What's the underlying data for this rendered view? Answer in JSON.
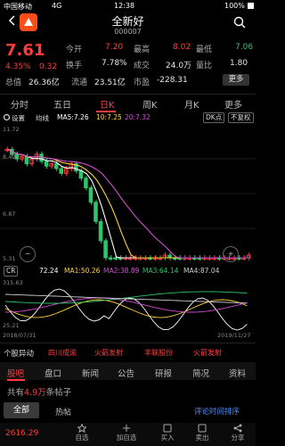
{
  "status": {
    "carrier": "中国移动",
    "network": "4G",
    "time": "12:38",
    "battery": "100%"
  },
  "header": {
    "title": "全新好",
    "code": "000007"
  },
  "quote": {
    "price": "7.61",
    "change_pct": "4.35%",
    "change": "0.32",
    "stats": [
      {
        "label": "今开",
        "value": "7.20"
      },
      {
        "label": "最高",
        "value": "8.02"
      },
      {
        "label": "最低",
        "value": "7.06"
      },
      {
        "label": "换手",
        "value": "7.78%"
      },
      {
        "label": "成交",
        "value": "24.0万"
      },
      {
        "label": "量比",
        "value": "1.80"
      },
      {
        "label": "总值",
        "value": "26.36亿"
      },
      {
        "label": "流通",
        "value": "23.51亿"
      },
      {
        "label": "市盈",
        "value": "-228.31"
      }
    ],
    "more_label": "更多"
  },
  "tabs": [
    "分时",
    "五日",
    "日K",
    "周K",
    "月K",
    "更多"
  ],
  "active_tab": "日K",
  "toolbar": {
    "settings": "设置",
    "ma_label": "均线",
    "ma5": "MA5:7.26",
    "ma10": "10:7.25",
    "ma20": "20:7.32",
    "dk_label": "DK点",
    "fq_label": "不复权"
  },
  "kline_axis": {
    "top": "11.72",
    "mid_high": "8.42",
    "mid": "6.87",
    "bottom": "5.31"
  },
  "volume": {
    "indicator": "CR",
    "cr": "72.24",
    "ma1": "MA1:50.26",
    "ma2": "MA2:38.89",
    "ma3": "MA3:64.14",
    "ma4": "MA4:87.04",
    "axis_top": "315.63",
    "axis_bottom": "25.21",
    "date_start": "2018/07/31",
    "date_end": "2019/11/27"
  },
  "signals": {
    "title": "个股异动",
    "items": [
      "四川成渝",
      "火箭发射",
      "丰联股份",
      "火箭发射"
    ]
  },
  "news_tabs": [
    "股吧",
    "盘口",
    "新闻",
    "公告",
    "研报",
    "简况",
    "资料"
  ],
  "news_active": "股吧",
  "community": {
    "prefix": "共有",
    "count": "4.9万",
    "suffix": "条帖子"
  },
  "filter": {
    "all": "全部",
    "hot": "热帖",
    "sort": "评论时间排序"
  },
  "bottom": {
    "index_value": "2616.29",
    "items": [
      "自选",
      "加自选",
      "买入",
      "卖出",
      "分享"
    ]
  },
  "colors": {
    "up": "#ff3b3b",
    "down": "#2fc46b",
    "ma5": "#ffffff",
    "ma10": "#ffd23b",
    "ma20": "#d04fd0"
  },
  "chart_data": {
    "type": "candlestick",
    "closes": [
      8.5,
      8.4,
      8.3,
      8.35,
      8.2,
      8.3,
      8.4,
      8.25,
      8.15,
      8.2,
      8.1,
      8.0,
      8.1,
      8.2,
      8.05,
      7.9,
      7.7,
      7.4,
      7.0,
      6.6,
      6.2,
      5.9,
      5.6,
      5.4,
      5.5,
      5.7,
      5.8,
      6.0,
      6.1,
      5.9,
      6.0,
      6.2,
      6.3,
      6.1,
      6.0,
      5.9,
      6.0,
      6.1,
      6.0,
      5.95,
      6.0,
      6.05,
      6.1,
      6.0,
      6.05,
      6.1,
      6.15,
      6.0,
      6.1,
      6.3
    ]
  }
}
